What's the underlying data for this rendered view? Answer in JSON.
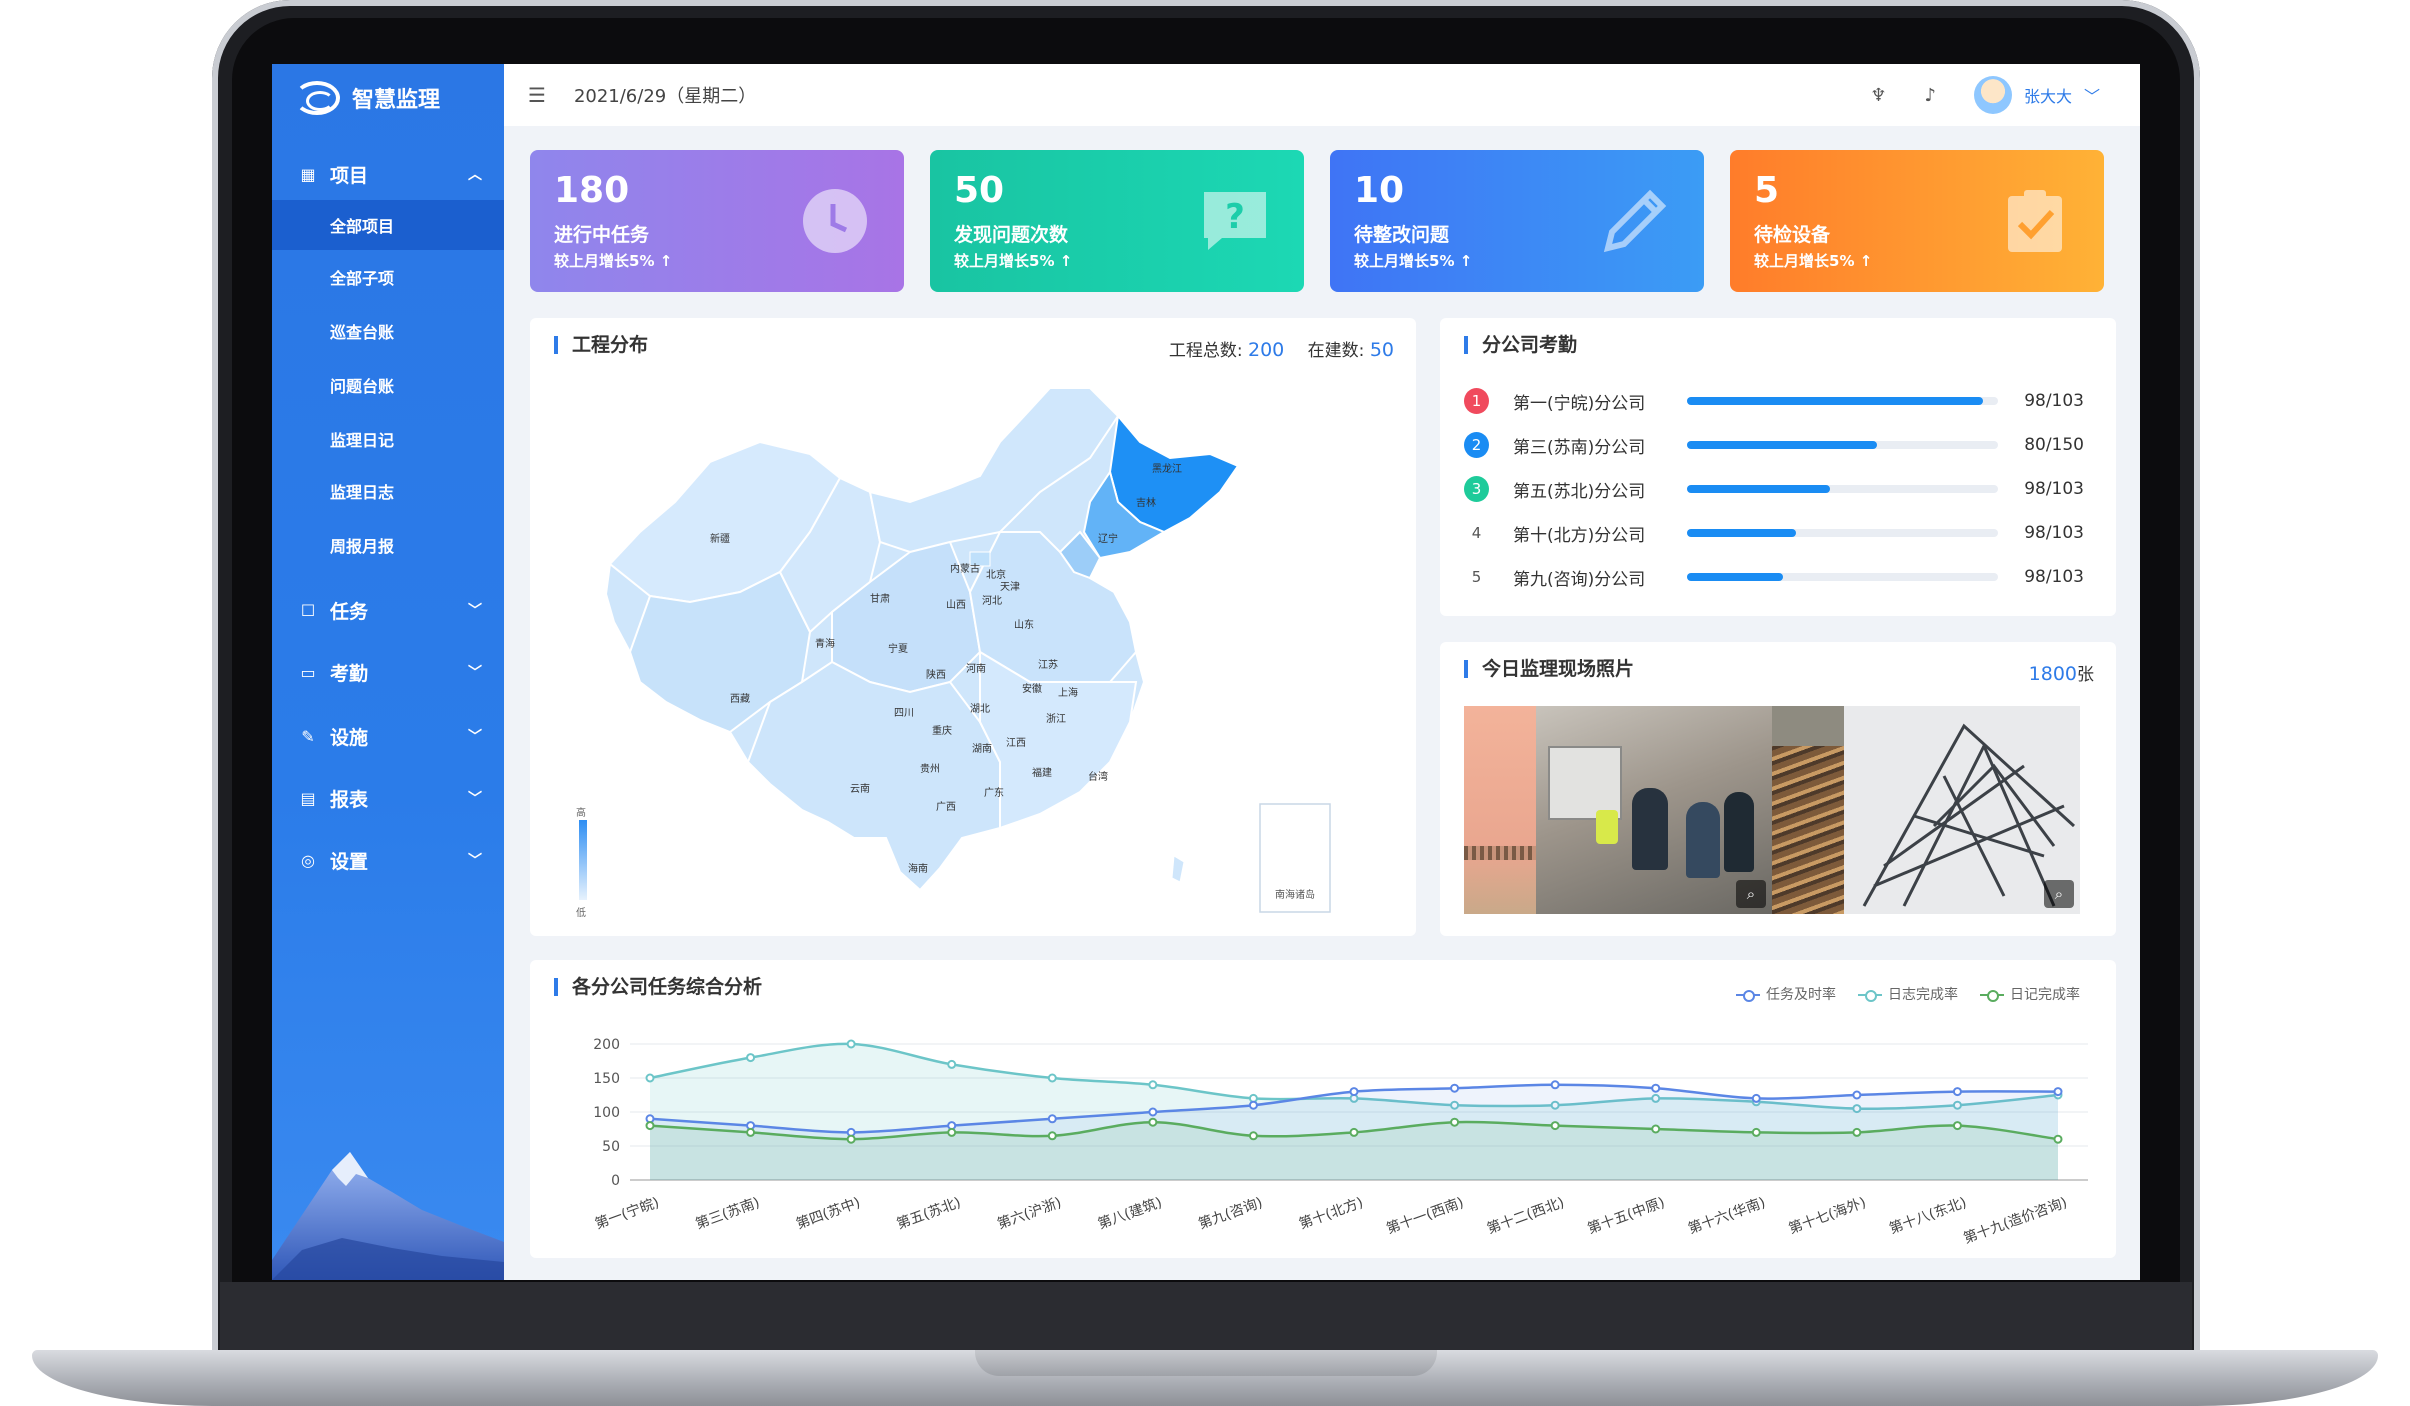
{
  "app": {
    "name": "智慧监理"
  },
  "header": {
    "date": "2021/6/29（星期二）",
    "user": "张大大"
  },
  "sidebar": {
    "groups": [
      {
        "label": "项目",
        "icon": "project-board-icon",
        "expanded": true
      },
      {
        "label": "任务",
        "icon": "clipboard-icon"
      },
      {
        "label": "考勤",
        "icon": "calendar-icon"
      },
      {
        "label": "设施",
        "icon": "wrench-icon"
      },
      {
        "label": "报表",
        "icon": "report-icon"
      },
      {
        "label": "设置",
        "icon": "settings-icon"
      }
    ],
    "project_items": [
      "全部项目",
      "全部子项",
      "巡查台账",
      "问题台账",
      "监理日记",
      "监理日志",
      "周报月报"
    ],
    "active_item": "全部项目"
  },
  "cards": [
    {
      "value": "180",
      "label": "进行中任务",
      "sub": "较上月增长5% ↑",
      "icon": "clock-icon",
      "from": "#8f86ec",
      "to": "#a874e6"
    },
    {
      "value": "50",
      "label": "发现问题次数",
      "sub": "较上月增长5% ↑",
      "icon": "question-chat-icon",
      "from": "#19c4a2",
      "to": "#1cd8b4"
    },
    {
      "value": "10",
      "label": "待整改问题",
      "sub": "较上月增长5% ↑",
      "icon": "pencil-icon",
      "from": "#3f74f5",
      "to": "#3b9cf5"
    },
    {
      "value": "5",
      "label": "待检设备",
      "sub": "较上月增长5% ↑",
      "icon": "checklist-icon",
      "from": "#ff7c2a",
      "to": "#ffb236"
    }
  ],
  "distribution": {
    "title": "工程分布",
    "total_label": "工程总数:",
    "total": "200",
    "building_label": "在建数:",
    "building": "50",
    "legend_high": "高",
    "legend_low": "低",
    "regions": [
      "新疆",
      "西藏",
      "青海",
      "甘肃",
      "内蒙古",
      "宁夏",
      "陕西",
      "山西",
      "河北",
      "北京",
      "天津",
      "山东",
      "河南",
      "四川",
      "重庆",
      "湖北",
      "安徽",
      "江苏",
      "上海",
      "浙江",
      "湖南",
      "江西",
      "福建",
      "贵州",
      "云南",
      "广西",
      "广东",
      "海南",
      "台湾",
      "黑龙江",
      "吉林",
      "辽宁",
      "南海诸岛"
    ]
  },
  "attendance": {
    "title": "分公司考勤",
    "rows": [
      {
        "rank": "1",
        "name": "第一(宁皖)分公司",
        "value": "98/103",
        "ratio": 0.95,
        "badge": "#f04a5d"
      },
      {
        "rank": "2",
        "name": "第三(苏南)分公司",
        "value": "80/150",
        "ratio": 0.61,
        "badge": "#1a8cf3"
      },
      {
        "rank": "3",
        "name": "第五(苏北)分公司",
        "value": "98/103",
        "ratio": 0.46,
        "badge": "#1ecb9a"
      },
      {
        "rank": "4",
        "name": "第十(北方)分公司",
        "value": "98/103",
        "ratio": 0.35,
        "badge": ""
      },
      {
        "rank": "5",
        "name": "第九(咨询)分公司",
        "value": "98/103",
        "ratio": 0.31,
        "badge": ""
      }
    ]
  },
  "photos": {
    "title": "今日监理现场照片",
    "count": "1800",
    "unit": "张"
  },
  "analysis": {
    "title": "各分公司任务综合分析"
  },
  "chart_data": {
    "type": "line",
    "title": "各分公司任务综合分析",
    "categories": [
      "第一(宁皖)",
      "第三(苏南)",
      "第四(苏中)",
      "第五(苏北)",
      "第六(沪浙)",
      "第八(建筑)",
      "第九(咨询)",
      "第十(北方)",
      "第十一(西南)",
      "第十二(西北)",
      "第十五(中原)",
      "第十六(华南)",
      "第十七(海外)",
      "第十八(东北)",
      "第十九(造价咨询)"
    ],
    "ylim": [
      0,
      200
    ],
    "yticks": [
      0,
      50,
      100,
      150,
      200
    ],
    "grid": true,
    "legend_position": "top-right",
    "series": [
      {
        "name": "任务及时率",
        "color": "#5b86e5",
        "values": [
          90,
          80,
          70,
          80,
          90,
          100,
          110,
          130,
          135,
          140,
          135,
          120,
          125,
          130,
          130
        ]
      },
      {
        "name": "日志完成率",
        "color": "#6cc5c8",
        "values": [
          150,
          180,
          200,
          170,
          150,
          140,
          120,
          120,
          110,
          110,
          120,
          115,
          105,
          110,
          125
        ]
      },
      {
        "name": "日记完成率",
        "color": "#5aac5f",
        "values": [
          80,
          70,
          60,
          70,
          65,
          85,
          65,
          70,
          85,
          80,
          75,
          70,
          70,
          80,
          60
        ]
      }
    ]
  }
}
